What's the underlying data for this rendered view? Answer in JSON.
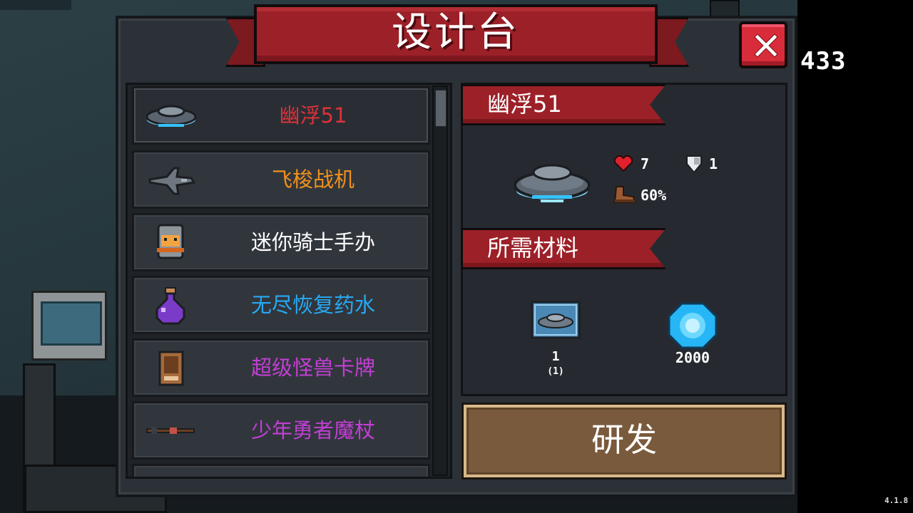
{
  "title": "设计台",
  "coins": "433",
  "version": "4.1.8",
  "items": [
    {
      "name": "幽浮51",
      "color": "#e0303a",
      "icon": "ufo-icon"
    },
    {
      "name": "飞梭战机",
      "color": "#f2911b",
      "icon": "fighter-jet-icon"
    },
    {
      "name": "迷你骑士手办",
      "color": "#ffffff",
      "icon": "knight-figure-icon"
    },
    {
      "name": "无尽恢复药水",
      "color": "#27a9f2",
      "icon": "potion-icon"
    },
    {
      "name": "超级怪兽卡牌",
      "color": "#c23fd4",
      "icon": "monster-card-icon"
    },
    {
      "name": "少年勇者魔杖",
      "color": "#c23fd4",
      "icon": "wand-icon"
    }
  ],
  "detail": {
    "name": "幽浮51",
    "hp": "7",
    "armor": "1",
    "speed": "60%",
    "materials_title": "所需材料",
    "materials": [
      {
        "icon": "blueprint-icon",
        "count": "1",
        "owned": "(1)"
      },
      {
        "icon": "gem-icon",
        "count": "2000"
      }
    ],
    "research_label": "研发"
  }
}
